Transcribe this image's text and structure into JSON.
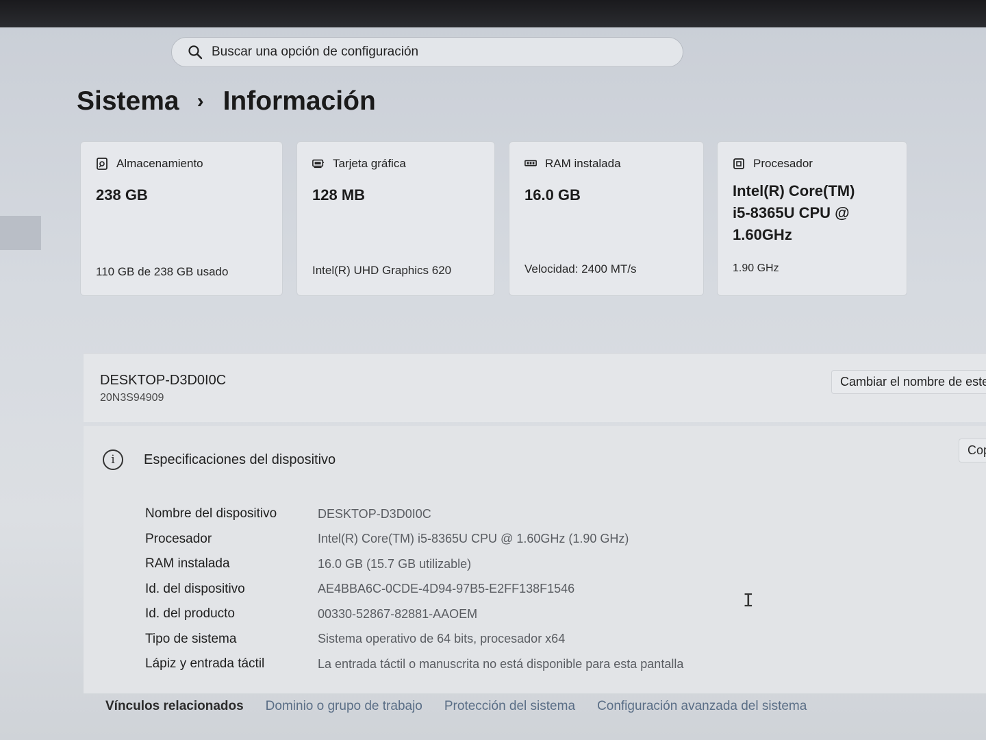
{
  "search": {
    "placeholder": "Buscar una opción de configuración",
    "icon": "search-icon"
  },
  "breadcrumb": {
    "parent": "Sistema",
    "separator": "›",
    "current": "Información"
  },
  "cards": [
    {
      "icon": "storage-icon",
      "title": "Almacenamiento",
      "value": "238 GB",
      "sub": "110 GB de 238 GB usado"
    },
    {
      "icon": "gpu-icon",
      "title": "Tarjeta gráfica",
      "value": "128 MB",
      "sub": "Intel(R) UHD Graphics 620"
    },
    {
      "icon": "ram-icon",
      "title": "RAM instalada",
      "value": "16.0 GB",
      "sub": "Velocidad: 2400 MT/s"
    },
    {
      "icon": "cpu-icon",
      "title": "Procesador",
      "value": "Intel(R) Core(TM) i5-8365U CPU @ 1.60GHz",
      "sub": "1.90 GHz"
    }
  ],
  "device": {
    "name": "DESKTOP-D3D0I0C",
    "model": "20N3S94909",
    "rename_label": "Cambiar el nombre de este equipo"
  },
  "specs": {
    "title": "Especificaciones del dispositivo",
    "copy_label": "Copiar",
    "rows": [
      {
        "label": "Nombre del dispositivo",
        "value": "DESKTOP-D3D0I0C"
      },
      {
        "label": "Procesador",
        "value": "Intel(R) Core(TM) i5-8365U CPU @ 1.60GHz (1.90 GHz)"
      },
      {
        "label": "RAM instalada",
        "value": "16.0 GB (15.7 GB utilizable)"
      },
      {
        "label": "Id. del dispositivo",
        "value": "AE4BBA6C-0CDE-4D94-97B5-E2FF138F1546"
      },
      {
        "label": "Id. del producto",
        "value": "00330-52867-82881-AAOEM"
      },
      {
        "label": "Tipo de sistema",
        "value": "Sistema operativo de 64 bits, procesador x64"
      },
      {
        "label": "Lápiz y entrada táctil",
        "value": "La entrada táctil o manuscrita no está disponible para esta pantalla"
      }
    ]
  },
  "related": {
    "label": "Vínculos relacionados",
    "links": [
      "Dominio o grupo de trabajo",
      "Protección del sistema",
      "Configuración avanzada del sistema"
    ]
  }
}
